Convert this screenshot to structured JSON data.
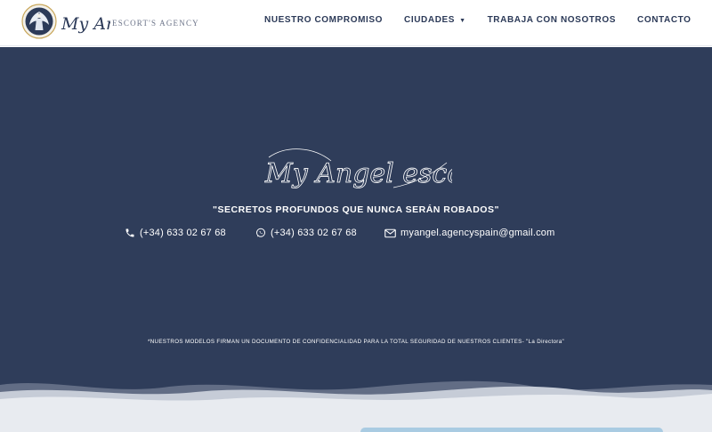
{
  "header": {
    "logo_text": "My Angel",
    "logo_subtitle": "ESCORT'S AGENCY",
    "nav": [
      {
        "label": "NUESTRO COMPROMISO"
      },
      {
        "label": "CIUDADES",
        "has_dropdown": true
      },
      {
        "label": "TRABAJA CON NOSOTROS"
      },
      {
        "label": "CONTACTO"
      }
    ]
  },
  "hero": {
    "script_title": "My Angel escort",
    "tagline": "\"SECRETOS PROFUNDOS QUE NUNCA SERÁN ROBADOS\"",
    "contacts": [
      {
        "icon": "phone-icon",
        "text": "(+34) 633 02 67 68"
      },
      {
        "icon": "whatsapp-icon",
        "text": "(+34) 633 02 67 68"
      },
      {
        "icon": "envelope-icon",
        "text": "myangel.agencyspain@gmail.com"
      }
    ],
    "footnote": "*NUESTROS MODELOS FIRMAN UN DOCUMENTO DE CONFIDENCIALIDAD PARA LA TOTAL SEGURIDAD DE NUESTROS CLIENTES- \"La Directora\""
  },
  "colors": {
    "hero_bg": "#2f3d5a",
    "nav_text": "#2c3a58",
    "wave_light": "#e8ebf0",
    "wave_mid": "#c6ccd7"
  }
}
